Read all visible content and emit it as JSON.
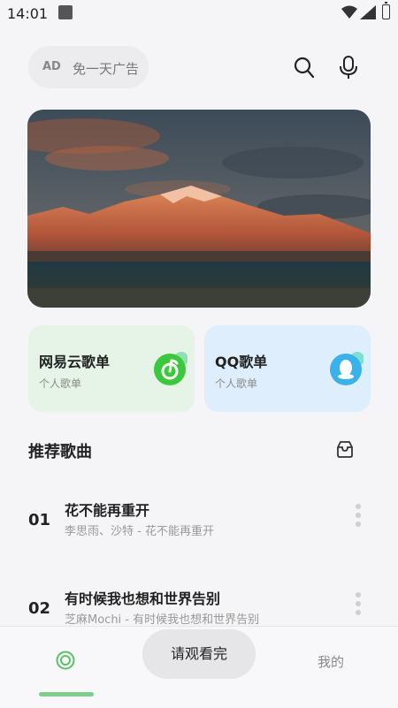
{
  "status_bar": {
    "time": "14:01"
  },
  "search": {
    "placeholder": "免一天广告",
    "adfree_badge": "AD"
  },
  "cards": [
    {
      "title": "网易云歌单",
      "subtitle": "个人歌单",
      "accent": "#3cc83c"
    },
    {
      "title": "QQ歌单",
      "subtitle": "个人歌单",
      "accent": "#39b1ea"
    }
  ],
  "recommended": {
    "title": "推荐歌曲",
    "songs": [
      {
        "num": "01",
        "title": "花不能再重开",
        "subtitle": "李思雨、沙特 - 花不能再重开"
      },
      {
        "num": "02",
        "title": "有时候我也想和世界告别",
        "subtitle": "芝麻Mochi - 有时候我也想和世界告别"
      }
    ]
  },
  "toast": {
    "text": "请观看完"
  },
  "bottom_nav": {
    "mine_label": "我的"
  },
  "colors": {
    "background": "#f5f5f7",
    "green_accent": "#7fcf8a"
  }
}
